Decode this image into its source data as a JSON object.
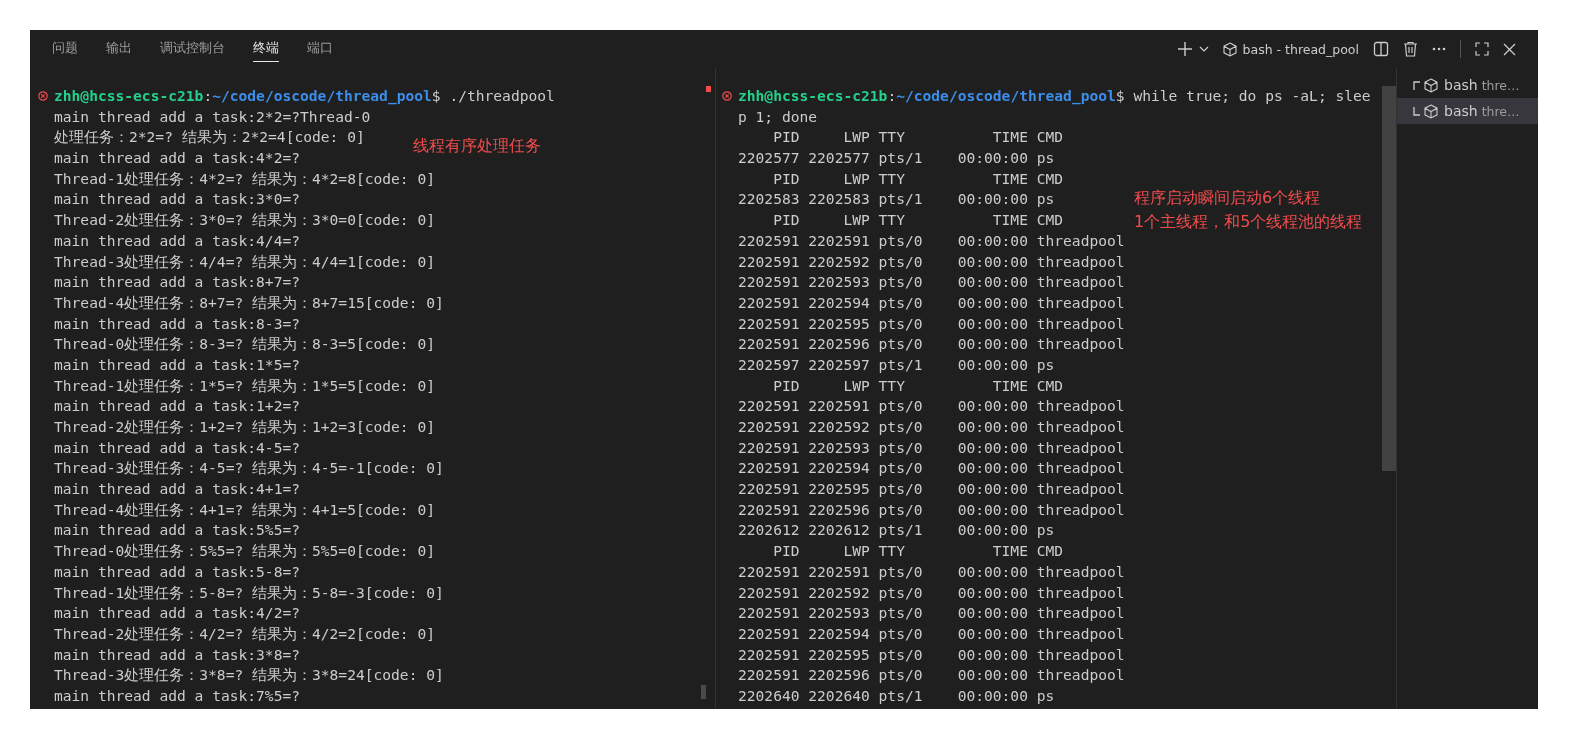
{
  "tabs": [
    {
      "label": "问题",
      "selected": false
    },
    {
      "label": "输出",
      "selected": false
    },
    {
      "label": "调试控制台",
      "selected": false
    },
    {
      "label": "终端",
      "selected": true
    },
    {
      "label": "端口",
      "selected": false
    }
  ],
  "toolbar": {
    "terminal_title": "bash - thread_pool"
  },
  "panes": [
    {
      "prompt": {
        "user": "zhh@hcss-ecs-c21b",
        "separator": ":",
        "path": "~/code/oscode/thread_pool",
        "command": "$ ./threadpool"
      },
      "lines": [
        "main thread add a task:2*2=?Thread-0",
        "处理任务：2*2=? 结果为：2*2=4[code: 0]",
        "main thread add a task:4*2=?",
        "Thread-1处理任务：4*2=? 结果为：4*2=8[code: 0]",
        "main thread add a task:3*0=?",
        "Thread-2处理任务：3*0=? 结果为：3*0=0[code: 0]",
        "main thread add a task:4/4=?",
        "Thread-3处理任务：4/4=? 结果为：4/4=1[code: 0]",
        "main thread add a task:8+7=?",
        "Thread-4处理任务：8+7=? 结果为：8+7=15[code: 0]",
        "main thread add a task:8-3=?",
        "Thread-0处理任务：8-3=? 结果为：8-3=5[code: 0]",
        "main thread add a task:1*5=?",
        "Thread-1处理任务：1*5=? 结果为：1*5=5[code: 0]",
        "main thread add a task:1+2=?",
        "Thread-2处理任务：1+2=? 结果为：1+2=3[code: 0]",
        "main thread add a task:4-5=?",
        "Thread-3处理任务：4-5=? 结果为：4-5=-1[code: 0]",
        "main thread add a task:4+1=?",
        "Thread-4处理任务：4+1=? 结果为：4+1=5[code: 0]",
        "main thread add a task:5%5=?",
        "Thread-0处理任务：5%5=? 结果为：5%5=0[code: 0]",
        "main thread add a task:5-8=?",
        "Thread-1处理任务：5-8=? 结果为：5-8=-3[code: 0]",
        "main thread add a task:4/2=?",
        "Thread-2处理任务：4/2=? 结果为：4/2=2[code: 0]",
        "main thread add a task:3*8=?",
        "Thread-3处理任务：3*8=? 结果为：3*8=24[code: 0]",
        "main thread add a task:7%5=?"
      ],
      "annotations": [
        "线程有序处理任务"
      ]
    },
    {
      "prompt": {
        "user": "zhh@hcss-ecs-c21b",
        "separator": ":",
        "path": "~/code/oscode/thread_pool",
        "command": "$ while true; do ps -aL; slee"
      },
      "lines": [
        "p 1; done",
        "    PID     LWP TTY          TIME CMD",
        "2202577 2202577 pts/1    00:00:00 ps",
        "    PID     LWP TTY          TIME CMD",
        "2202583 2202583 pts/1    00:00:00 ps",
        "    PID     LWP TTY          TIME CMD",
        "2202591 2202591 pts/0    00:00:00 threadpool",
        "2202591 2202592 pts/0    00:00:00 threadpool",
        "2202591 2202593 pts/0    00:00:00 threadpool",
        "2202591 2202594 pts/0    00:00:00 threadpool",
        "2202591 2202595 pts/0    00:00:00 threadpool",
        "2202591 2202596 pts/0    00:00:00 threadpool",
        "2202597 2202597 pts/1    00:00:00 ps",
        "    PID     LWP TTY          TIME CMD",
        "2202591 2202591 pts/0    00:00:00 threadpool",
        "2202591 2202592 pts/0    00:00:00 threadpool",
        "2202591 2202593 pts/0    00:00:00 threadpool",
        "2202591 2202594 pts/0    00:00:00 threadpool",
        "2202591 2202595 pts/0    00:00:00 threadpool",
        "2202591 2202596 pts/0    00:00:00 threadpool",
        "2202612 2202612 pts/1    00:00:00 ps",
        "    PID     LWP TTY          TIME CMD",
        "2202591 2202591 pts/0    00:00:00 threadpool",
        "2202591 2202592 pts/0    00:00:00 threadpool",
        "2202591 2202593 pts/0    00:00:00 threadpool",
        "2202591 2202594 pts/0    00:00:00 threadpool",
        "2202591 2202595 pts/0    00:00:00 threadpool",
        "2202591 2202596 pts/0    00:00:00 threadpool",
        "2202640 2202640 pts/1    00:00:00 ps"
      ],
      "annotations": [
        "程序启动瞬间启动6个线程",
        "1个主线程，和5个线程池的线程"
      ]
    }
  ],
  "terminal_list": [
    {
      "name": "bash",
      "detail": "thre…",
      "selected": false
    },
    {
      "name": "bash",
      "detail": "thre…",
      "selected": true
    }
  ]
}
